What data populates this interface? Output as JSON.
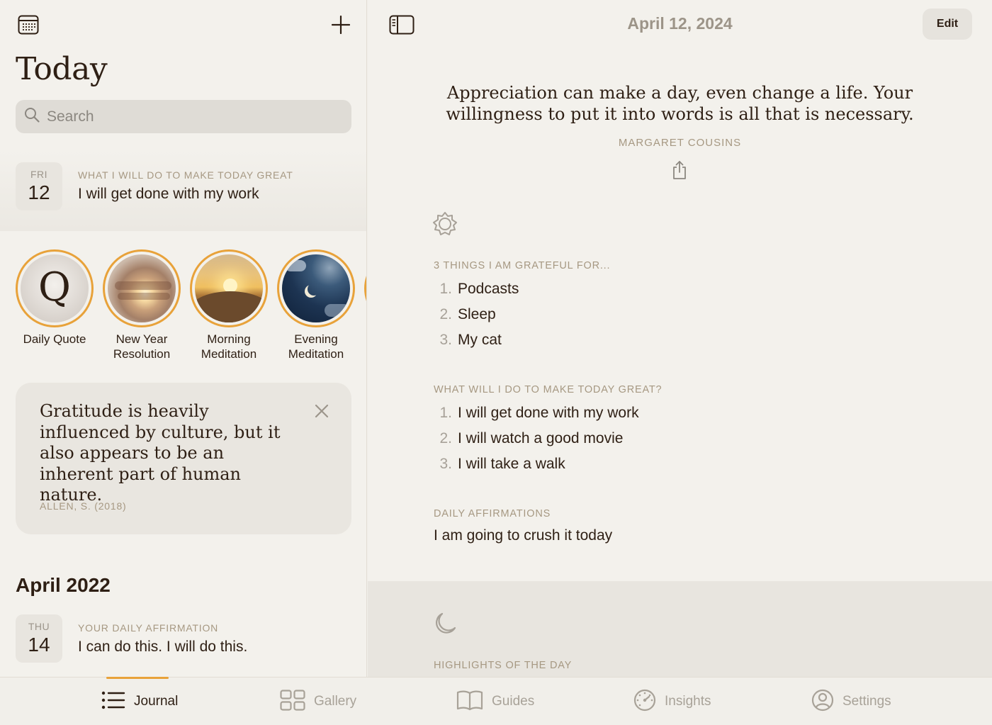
{
  "left": {
    "title": "Today",
    "search_placeholder": "Search",
    "today_entry": {
      "day_of_week": "FRI",
      "day": "12",
      "label": "WHAT I WILL DO TO MAKE TODAY GREAT",
      "text": "I will get done with my work"
    },
    "stories": [
      {
        "label": "Daily Quote",
        "glyph": "Q"
      },
      {
        "label": "New Year\nResolution"
      },
      {
        "label": "Morning\nMeditation"
      },
      {
        "label": "Evening\nMeditation"
      }
    ],
    "quote_card": {
      "text": "Gratitude is heavily influenced by culture, but it also appears to be an inherent part of human nature.",
      "source": "ALLEN, S. (2018)"
    },
    "month_header": "April 2022",
    "past_entry": {
      "day_of_week": "THU",
      "day": "14",
      "label": "YOUR DAILY AFFIRMATION",
      "text": "I can do this. I will do this."
    }
  },
  "right": {
    "date_title": "April 12, 2024",
    "edit_label": "Edit",
    "quote": "Appreciation can make a day, even change a life. Your willingness to put it into words is all that is necessary.",
    "quote_author": "MARGARET COUSINS",
    "grateful": {
      "label": "3 THINGS I AM GRATEFUL FOR...",
      "items": [
        "Podcasts",
        "Sleep",
        "My cat"
      ]
    },
    "great": {
      "label": "WHAT WILL I DO TO MAKE TODAY GREAT?",
      "items": [
        "I will get done with my work",
        "I will watch a good movie",
        "I will take a walk"
      ]
    },
    "affirmations": {
      "label": "DAILY AFFIRMATIONS",
      "text": "I am going to crush it today"
    },
    "highlights_label": "HIGHLIGHTS OF THE DAY"
  },
  "tabs": [
    {
      "label": "Journal",
      "icon": "list-icon",
      "active": true
    },
    {
      "label": "Gallery",
      "icon": "grid-icon"
    },
    {
      "label": "Guides",
      "icon": "book-icon"
    },
    {
      "label": "Insights",
      "icon": "gauge-icon"
    },
    {
      "label": "Settings",
      "icon": "person-circle-icon"
    }
  ],
  "colors": {
    "accent": "#e8a23a",
    "background": "#f3f1ec",
    "text": "#2e1f14",
    "muted_label": "#a69882"
  }
}
